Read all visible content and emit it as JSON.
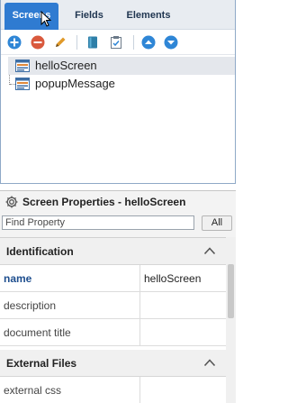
{
  "tabs": [
    {
      "label": "Screens"
    },
    {
      "label": "Fields"
    },
    {
      "label": "Elements"
    }
  ],
  "toolbar_icons": [
    "add-icon",
    "delete-icon",
    "edit-icon",
    "book-icon",
    "checklist-icon",
    "move-up-icon",
    "move-down-icon"
  ],
  "tree": {
    "items": [
      {
        "label": "helloScreen"
      },
      {
        "label": "popupMessage"
      }
    ]
  },
  "properties": {
    "title": "Screen Properties - helloScreen",
    "search_placeholder": "Find Property",
    "all_label": "All",
    "sections": [
      {
        "label": "Identification",
        "rows": [
          {
            "name": "name",
            "value": "helloScreen"
          },
          {
            "name": "description",
            "value": ""
          },
          {
            "name": "document title",
            "value": ""
          }
        ]
      },
      {
        "label": "External Files",
        "rows": [
          {
            "name": "external css",
            "value": ""
          }
        ]
      }
    ]
  },
  "colors": {
    "active_tab": "#2f7bd1",
    "add": "#2f86d6",
    "delete": "#d9593d",
    "edit": "#e09a2a",
    "nav": "#2f86d6"
  }
}
